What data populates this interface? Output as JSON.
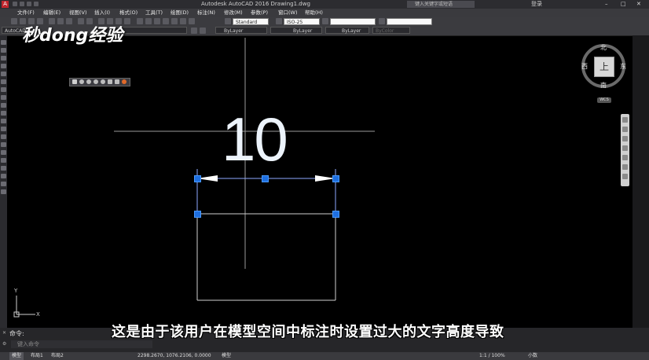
{
  "window": {
    "title": "Autodesk AutoCAD 2016    Drawing1.dwg",
    "search_placeholder": "键入关键字或短语",
    "login_label": "登录"
  },
  "menu": [
    "文件(F)",
    "编辑(E)",
    "视图(V)",
    "插入(I)",
    "格式(O)",
    "工具(T)",
    "绘图(D)",
    "标注(N)",
    "修改(M)",
    "参数(P)",
    "窗口(W)",
    "帮助(H)"
  ],
  "toolbar": {
    "text_style": "Standard",
    "dim_style": "ISO-25",
    "workspace": "AutoCAD"
  },
  "properties": {
    "layer": "ByLayer",
    "linetype": "ByLayer",
    "lineweight": "ByLayer",
    "color": "ByColor"
  },
  "viewcube": {
    "north": "北",
    "south": "南",
    "east": "东",
    "west": "西",
    "face": "上",
    "wcs": "WCS"
  },
  "drawing": {
    "dimension_text": "10"
  },
  "ucs": {
    "y_label": "Y",
    "x_label": "X"
  },
  "watermark": "秒dong经验",
  "subtitle": "这是由于该用户在模型空间中标注时设置过大的文字高度导致",
  "command": {
    "history_label": "命令:",
    "input_placeholder": "键入命令"
  },
  "status": {
    "tabs": [
      "模型",
      "布局1",
      "布局2"
    ],
    "coordinates": "2298.2670, 1076.2106, 0.0000",
    "mode": "模型",
    "scale": "1:1 / 100%",
    "units": "小数"
  },
  "colors": {
    "canvas": "#000000",
    "grip": "#1e6fe0",
    "dimension_line": "#8ea8ff"
  }
}
